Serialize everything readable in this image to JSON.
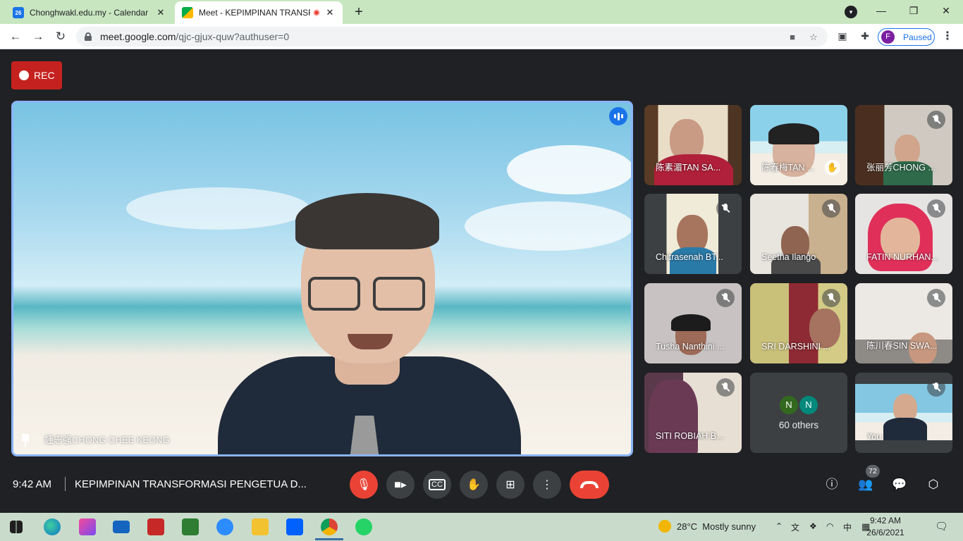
{
  "browser": {
    "tabs": [
      {
        "title": "Chonghwakl.edu.my - Calendar -",
        "favicon": "calendar-icon",
        "favicon_text": "26",
        "active": false
      },
      {
        "title": "Meet - KEPIMPINAN TRANSF",
        "favicon": "meet-icon",
        "active": true,
        "recording": true
      }
    ],
    "url_host": "meet.google.com",
    "url_path": "/qjc-gjux-quw?authuser=0",
    "profile_initial": "F",
    "profile_status": "Paused"
  },
  "meet": {
    "rec_label": "REC",
    "presenter_name": "鍾志强CHONG CHEE KEONG",
    "time": "9:42 AM",
    "meeting_title": "KEPIMPINAN TRANSFORMASI PENGETUA D...",
    "participant_count": "72",
    "participants": [
      {
        "name": "陈素湄TAN SA..."
      },
      {
        "name": "陈春梅TAN ..."
      },
      {
        "name": "张丽芳CHONG ..."
      },
      {
        "name": "Chitrasenah BT..."
      },
      {
        "name": "Seetha Ilango"
      },
      {
        "name": "FATIN NURHAN..."
      },
      {
        "name": "Tusha Nanthini ..."
      },
      {
        "name": "SRI DARSHINI ..."
      },
      {
        "name": "陈川春SIN SWA..."
      },
      {
        "name": "SITI ROBIAH B..."
      },
      {
        "name": "You"
      }
    ],
    "others": {
      "label": "60 others",
      "avatars": [
        "N",
        "N"
      ]
    },
    "colors": {
      "accent": "#1a73e8",
      "danger": "#ea4335",
      "background": "#202124"
    }
  },
  "taskbar": {
    "weather_temp": "28°C",
    "weather_text": "Mostly sunny",
    "ime_label": "中",
    "time": "9:42 AM",
    "date": "26/6/2021"
  }
}
